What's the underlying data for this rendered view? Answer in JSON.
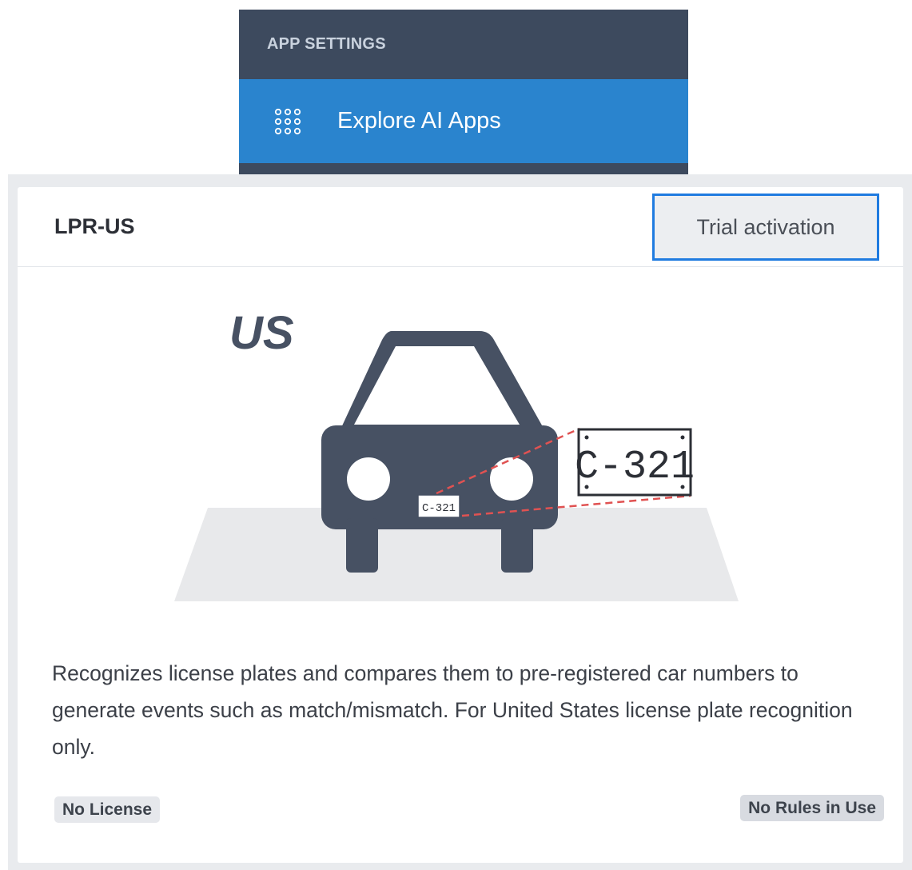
{
  "menu": {
    "header": "APP SETTINGS",
    "item": {
      "label": "Explore AI Apps",
      "icon": "grid-dots-icon"
    }
  },
  "card": {
    "title": "LPR-US",
    "trial_button": "Trial activation",
    "illustration": {
      "region_label": "US",
      "plate_text": "C-321",
      "icon": "car-license-plate-icon"
    },
    "description": "Recognizes license plates and compares them to pre-registered car numbers to generate events such as match/mismatch. For United States license plate recognition only.",
    "license_badge": "No License",
    "rules_badge": "No Rules in Use"
  },
  "colors": {
    "menu_bg": "#3d4a5e",
    "menu_active": "#2a84ce",
    "focus_border": "#1f7be0",
    "car": "#475163"
  }
}
